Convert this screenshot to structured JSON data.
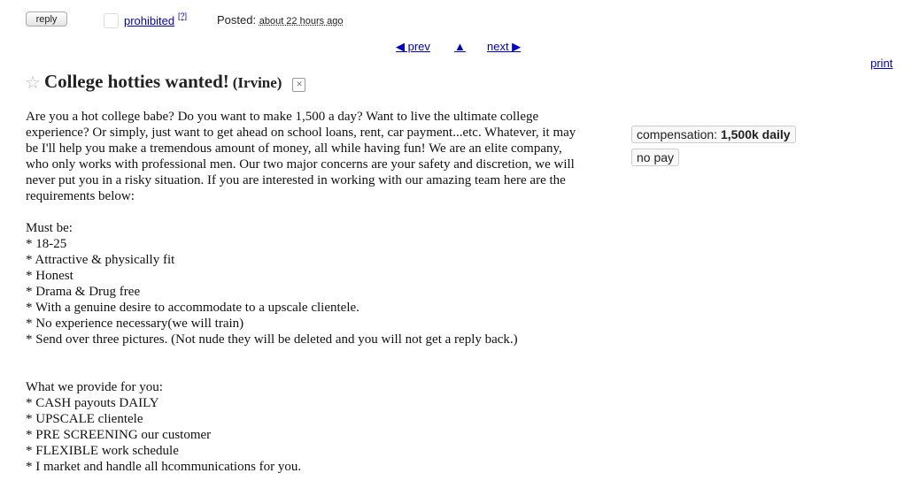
{
  "toolbar": {
    "reply_label": "reply",
    "flag_label": "prohibited",
    "flag_help": "[?]",
    "posted_label": "Posted:",
    "posted_time": "about 22 hours ago"
  },
  "nav": {
    "prev_label": "◀ prev",
    "up_label": "▲",
    "next_label": "next ▶",
    "print_label": "print"
  },
  "posting": {
    "star_icon": "star-icon",
    "title": "College hotties wanted!",
    "location": "(Irvine)",
    "hide_icon": "hide-icon",
    "intro": [
      "Are you a hot college babe? Do you want to make 1,500 a day? Want to live the ultimate college",
      "experience? Or simply, just want to get ahead on school loans, rent, car payment...etc. Whatever, it may",
      "be I'll help you make a tremendous amount of money, all while having fun! We are an elite company,",
      "who only works with professional men. Our two major concerns are your safety and discretion, we will",
      "never put you in a risky situation. If you are interested in working with our amazing team here are the",
      "requirements below:"
    ],
    "must_heading": "Must be:",
    "must_items": [
      "* 18-25",
      "* Attractive & physically fit",
      "* Honest",
      "* Drama & Drug free",
      "* With a genuine desire to accommodate to a upscale clientele.",
      "* No experience necessary(we will train)",
      "* Send over three pictures. (Not nude they will be deleted and you will not get a reply back.)"
    ],
    "provide_heading": "What we provide for you:",
    "provide_items": [
      "* CASH payouts DAILY",
      "* UPSCALE clientele",
      "* PRE SCREENING our customer",
      "* FLEXIBLE work schedule",
      "* I market and handle all hcommunications for you."
    ]
  },
  "attributes": {
    "compensation_label": "compensation:",
    "compensation_value": "1,500k daily",
    "no_pay": "no pay"
  }
}
